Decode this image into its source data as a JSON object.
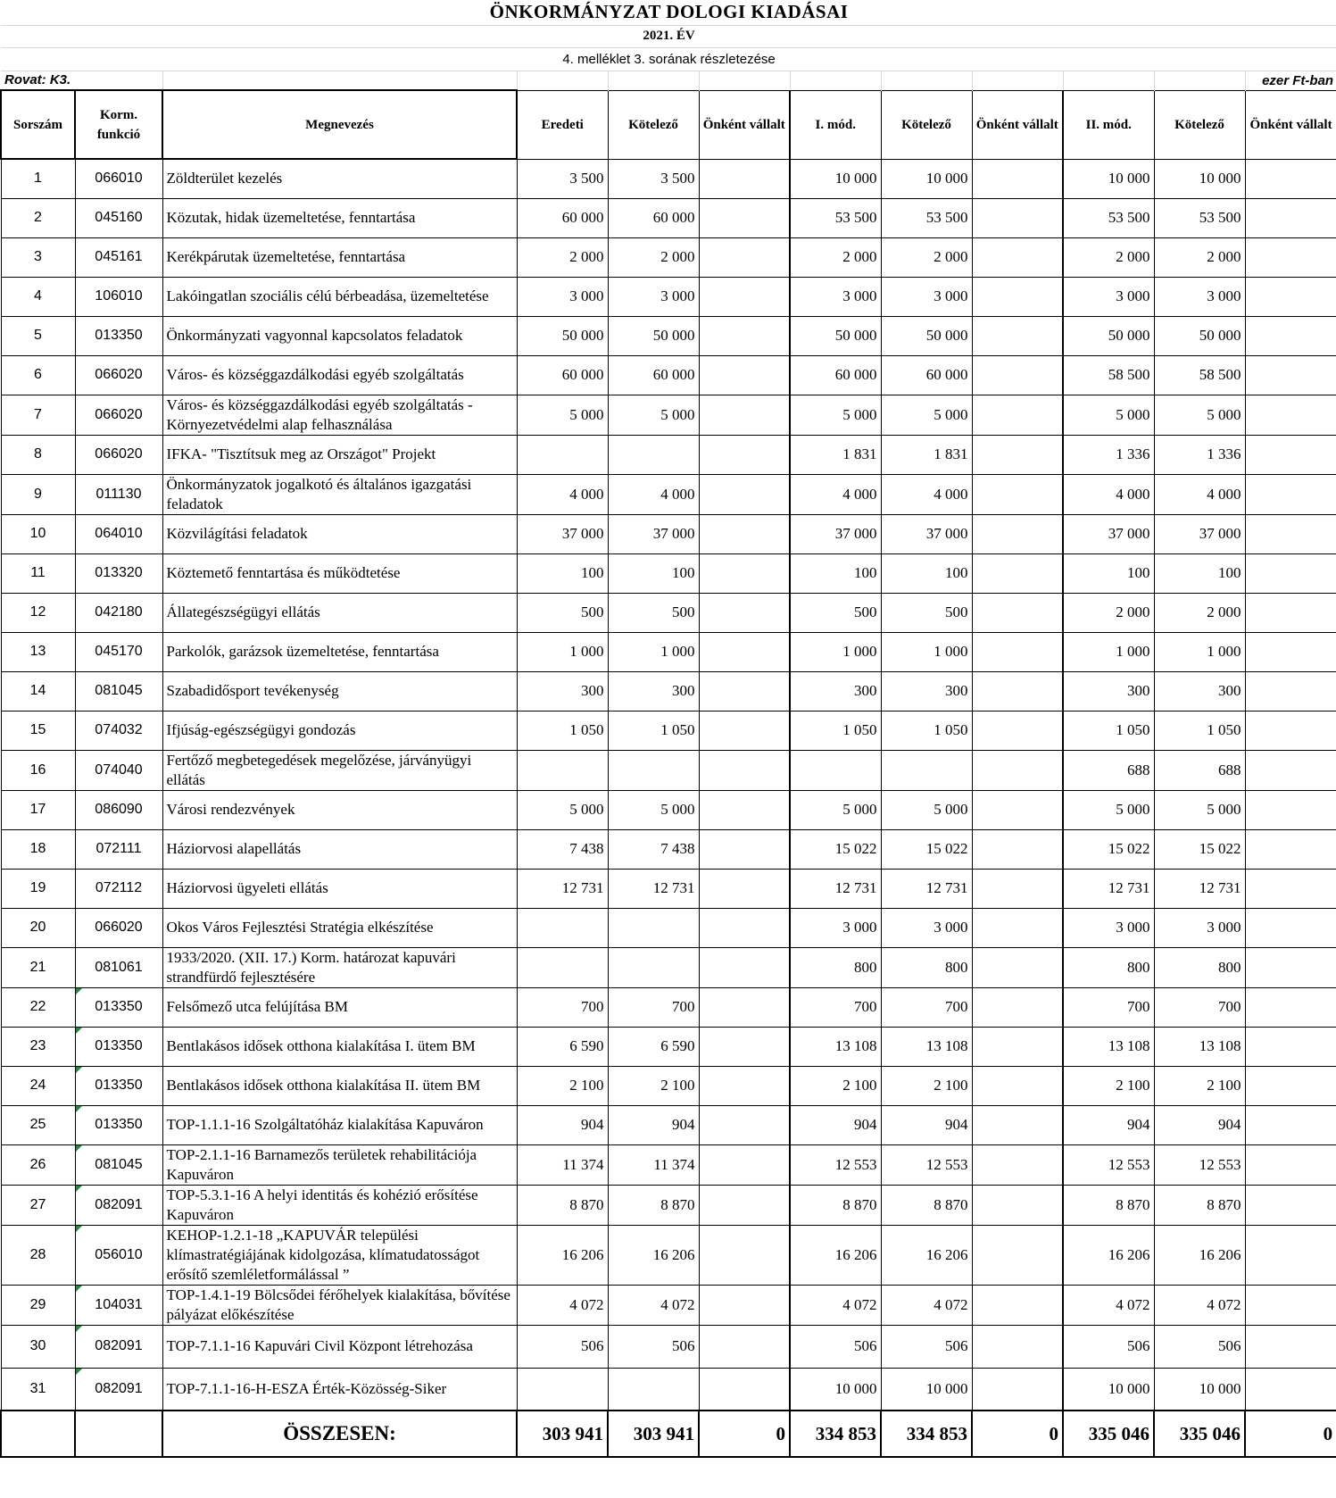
{
  "title": "ÖNKORMÁNYZAT DOLOGI KIADÁSAI",
  "year": "2021. ÉV",
  "subtitle": "4. melléklet 3. sorának részletezése",
  "rovat": "Rovat: K3.",
  "unit": "ezer Ft-ban",
  "headers": {
    "sorszam": "Sorszám",
    "korm": "Korm. funkció",
    "megnevezes": "Megnevezés",
    "eredeti": "Eredeti",
    "kotelezo1": "Kötelező",
    "onkent1": "Önként vállalt",
    "imod": "I. mód.",
    "kotelezo2": "Kötelező",
    "onkent2": "Önként vállalt",
    "iimod": "II. mód.",
    "kotelezo3": "Kötelező",
    "onkent3": "Önként vállalt"
  },
  "rows": [
    {
      "no": "1",
      "korm": "066010",
      "name": "Zöldterület kezelés",
      "eredeti": "3 500",
      "kot1": "3 500",
      "onk1": "",
      "imod": "10 000",
      "kot2": "10 000",
      "onk2": "",
      "iimod": "10 000",
      "kot3": "10 000",
      "onk3": ""
    },
    {
      "no": "2",
      "korm": "045160",
      "name": "Közutak, hidak üzemeltetése, fenntartása",
      "eredeti": "60 000",
      "kot1": "60 000",
      "onk1": "",
      "imod": "53 500",
      "kot2": "53 500",
      "onk2": "",
      "iimod": "53 500",
      "kot3": "53 500",
      "onk3": ""
    },
    {
      "no": "3",
      "korm": "045161",
      "name": "Kerékpárutak üzemeltetése, fenntartása",
      "eredeti": "2 000",
      "kot1": "2 000",
      "onk1": "",
      "imod": "2 000",
      "kot2": "2 000",
      "onk2": "",
      "iimod": "2 000",
      "kot3": "2 000",
      "onk3": ""
    },
    {
      "no": "4",
      "korm": "106010",
      "name": "Lakóingatlan szociális  célú bérbeadása, üzemeltetése",
      "eredeti": "3 000",
      "kot1": "3 000",
      "onk1": "",
      "imod": "3 000",
      "kot2": "3 000",
      "onk2": "",
      "iimod": "3 000",
      "kot3": "3 000",
      "onk3": ""
    },
    {
      "no": "5",
      "korm": "013350",
      "name": "Önkormányzati vagyonnal kapcsolatos feladatok",
      "eredeti": "50 000",
      "kot1": "50 000",
      "onk1": "",
      "imod": "50 000",
      "kot2": "50 000",
      "onk2": "",
      "iimod": "50 000",
      "kot3": "50 000",
      "onk3": ""
    },
    {
      "no": "6",
      "korm": "066020",
      "name": "Város- és községgazdálkodási egyéb szolgáltatás",
      "eredeti": "60 000",
      "kot1": "60 000",
      "onk1": "",
      "imod": "60 000",
      "kot2": "60 000",
      "onk2": "",
      "iimod": "58 500",
      "kot3": "58 500",
      "onk3": ""
    },
    {
      "no": "7",
      "korm": "066020",
      "name": "Város- és községgazdálkodási egyéb szolgáltatás  - Környezetvédelmi alap felhasználása",
      "eredeti": "5 000",
      "kot1": "5 000",
      "onk1": "",
      "imod": "5 000",
      "kot2": "5 000",
      "onk2": "",
      "iimod": "5 000",
      "kot3": "5 000",
      "onk3": ""
    },
    {
      "no": "8",
      "korm": "066020",
      "name": "IFKA- \"Tisztítsuk meg az Országot\" Projekt",
      "eredeti": "",
      "kot1": "",
      "onk1": "",
      "imod": "1 831",
      "kot2": "1 831",
      "onk2": "",
      "iimod": "1 336",
      "kot3": "1 336",
      "onk3": ""
    },
    {
      "no": "9",
      "korm": "011130",
      "name": "Önkormányzatok jogalkotó és általános igazgatási feladatok",
      "eredeti": "4 000",
      "kot1": "4 000",
      "onk1": "",
      "imod": "4 000",
      "kot2": "4 000",
      "onk2": "",
      "iimod": "4 000",
      "kot3": "4 000",
      "onk3": ""
    },
    {
      "no": "10",
      "korm": "064010",
      "name": "Közvilágítási feladatok",
      "eredeti": "37 000",
      "kot1": "37 000",
      "onk1": "",
      "imod": "37 000",
      "kot2": "37 000",
      "onk2": "",
      "iimod": "37 000",
      "kot3": "37 000",
      "onk3": ""
    },
    {
      "no": "11",
      "korm": "013320",
      "name": "Köztemető fenntartása és működtetése",
      "eredeti": "100",
      "kot1": "100",
      "onk1": "",
      "imod": "100",
      "kot2": "100",
      "onk2": "",
      "iimod": "100",
      "kot3": "100",
      "onk3": ""
    },
    {
      "no": "12",
      "korm": "042180",
      "name": "Állategészségügyi ellátás",
      "eredeti": "500",
      "kot1": "500",
      "onk1": "",
      "imod": "500",
      "kot2": "500",
      "onk2": "",
      "iimod": "2 000",
      "kot3": "2 000",
      "onk3": ""
    },
    {
      "no": "13",
      "korm": "045170",
      "name": "Parkolók, garázsok üzemeltetése, fenntartása",
      "eredeti": "1 000",
      "kot1": "1 000",
      "onk1": "",
      "imod": "1 000",
      "kot2": "1 000",
      "onk2": "",
      "iimod": "1 000",
      "kot3": "1 000",
      "onk3": ""
    },
    {
      "no": "14",
      "korm": "081045",
      "name": "Szabadidősport tevékenység",
      "eredeti": "300",
      "kot1": "300",
      "onk1": "",
      "imod": "300",
      "kot2": "300",
      "onk2": "",
      "iimod": "300",
      "kot3": "300",
      "onk3": ""
    },
    {
      "no": "15",
      "korm": "074032",
      "name": "Ifjúság-egészségügyi gondozás",
      "eredeti": "1 050",
      "kot1": "1 050",
      "onk1": "",
      "imod": "1 050",
      "kot2": "1 050",
      "onk2": "",
      "iimod": "1 050",
      "kot3": "1 050",
      "onk3": ""
    },
    {
      "no": "16",
      "korm": "074040",
      "name": "Fertőző megbetegedések megelőzése, járványügyi ellátás",
      "eredeti": "",
      "kot1": "",
      "onk1": "",
      "imod": "",
      "kot2": "",
      "onk2": "",
      "iimod": "688",
      "kot3": "688",
      "onk3": ""
    },
    {
      "no": "17",
      "korm": "086090",
      "name": "Városi rendezvények",
      "eredeti": "5 000",
      "kot1": "5 000",
      "onk1": "",
      "imod": "5 000",
      "kot2": "5 000",
      "onk2": "",
      "iimod": "5 000",
      "kot3": "5 000",
      "onk3": ""
    },
    {
      "no": "18",
      "korm": "072111",
      "name": "Háziorvosi alapellátás",
      "eredeti": "7 438",
      "kot1": "7 438",
      "onk1": "",
      "imod": "15 022",
      "kot2": "15 022",
      "onk2": "",
      "iimod": "15 022",
      "kot3": "15 022",
      "onk3": ""
    },
    {
      "no": "19",
      "korm": "072112",
      "name": "Háziorvosi ügyeleti ellátás",
      "eredeti": "12 731",
      "kot1": "12 731",
      "onk1": "",
      "imod": "12 731",
      "kot2": "12 731",
      "onk2": "",
      "iimod": "12 731",
      "kot3": "12 731",
      "onk3": ""
    },
    {
      "no": "20",
      "korm": "066020",
      "name": "Okos Város Fejlesztési Stratégia elkészítése",
      "eredeti": "",
      "kot1": "",
      "onk1": "",
      "imod": "3 000",
      "kot2": "3 000",
      "onk2": "",
      "iimod": "3 000",
      "kot3": "3 000",
      "onk3": ""
    },
    {
      "no": "21",
      "korm": "081061",
      "name": "1933/2020. (XII. 17.) Korm. határozat kapuvári strandfürdő fejlesztésére",
      "eredeti": "",
      "kot1": "",
      "onk1": "",
      "imod": "800",
      "kot2": "800",
      "onk2": "",
      "iimod": "800",
      "kot3": "800",
      "onk3": ""
    },
    {
      "no": "22",
      "korm": "013350",
      "name": "Felsőmező utca felújítása BM",
      "eredeti": "700",
      "kot1": "700",
      "onk1": "",
      "imod": "700",
      "kot2": "700",
      "onk2": "",
      "iimod": "700",
      "kot3": "700",
      "onk3": ""
    },
    {
      "no": "23",
      "korm": "013350",
      "name": "Bentlakásos idősek otthona kialakítása I. ütem BM",
      "eredeti": "6 590",
      "kot1": "6 590",
      "onk1": "",
      "imod": "13 108",
      "kot2": "13 108",
      "onk2": "",
      "iimod": "13 108",
      "kot3": "13 108",
      "onk3": ""
    },
    {
      "no": "24",
      "korm": "013350",
      "name": "Bentlakásos idősek otthona kialakítása II. ütem BM",
      "eredeti": "2 100",
      "kot1": "2 100",
      "onk1": "",
      "imod": "2 100",
      "kot2": "2 100",
      "onk2": "",
      "iimod": "2 100",
      "kot3": "2 100",
      "onk3": ""
    },
    {
      "no": "25",
      "korm": "013350",
      "name": "TOP-1.1.1-16 Szolgáltatóház kialakítása Kapuváron",
      "eredeti": "904",
      "kot1": "904",
      "onk1": "",
      "imod": "904",
      "kot2": "904",
      "onk2": "",
      "iimod": "904",
      "kot3": "904",
      "onk3": ""
    },
    {
      "no": "26",
      "korm": "081045",
      "name": "TOP-2.1.1-16 Barnamezős területek rehabilitációja Kapuváron",
      "eredeti": "11 374",
      "kot1": "11 374",
      "onk1": "",
      "imod": "12 553",
      "kot2": "12 553",
      "onk2": "",
      "iimod": "12 553",
      "kot3": "12 553",
      "onk3": ""
    },
    {
      "no": "27",
      "korm": "082091",
      "name": "TOP-5.3.1-16 A helyi identitás és kohézió erősítése Kapuváron",
      "eredeti": "8 870",
      "kot1": "8 870",
      "onk1": "",
      "imod": "8 870",
      "kot2": "8 870",
      "onk2": "",
      "iimod": "8 870",
      "kot3": "8 870",
      "onk3": ""
    },
    {
      "no": "28",
      "korm": "056010",
      "name": "KEHOP-1.2.1-18 „KAPUVÁR települési klímastratégiájának kidolgozása, klímatudatosságot erősítő szemléletformálással ”",
      "eredeti": "16 206",
      "kot1": "16 206",
      "onk1": "",
      "imod": "16 206",
      "kot2": "16 206",
      "onk2": "",
      "iimod": "16 206",
      "kot3": "16 206",
      "onk3": ""
    },
    {
      "no": "29",
      "korm": "104031",
      "name": "TOP-1.4.1-19 Bölcsődei férőhelyek kialakítása, bővítése pályázat előkészítése",
      "eredeti": "4 072",
      "kot1": "4 072",
      "onk1": "",
      "imod": "4 072",
      "kot2": "4 072",
      "onk2": "",
      "iimod": "4 072",
      "kot3": "4 072",
      "onk3": ""
    },
    {
      "no": "30",
      "korm": "082091",
      "name": "TOP-7.1.1-16 Kapuvári Civil Központ létrehozása",
      "eredeti": "506",
      "kot1": "506",
      "onk1": "",
      "imod": "506",
      "kot2": "506",
      "onk2": "",
      "iimod": "506",
      "kot3": "506",
      "onk3": ""
    },
    {
      "no": "31",
      "korm": "082091",
      "name": "TOP-7.1.1-16-H-ESZA Érték-Közösség-Siker",
      "eredeti": "",
      "kot1": "",
      "onk1": "",
      "imod": "10 000",
      "kot2": "10 000",
      "onk2": "",
      "iimod": "10 000",
      "kot3": "10 000",
      "onk3": ""
    }
  ],
  "total": {
    "label": "ÖSSZESEN:",
    "eredeti": "303 941",
    "kot1": "303 941",
    "onk1": "0",
    "imod": "334 853",
    "kot2": "334 853",
    "onk2": "0",
    "iimod": "335 046",
    "kot3": "335 046",
    "onk3": "0"
  }
}
